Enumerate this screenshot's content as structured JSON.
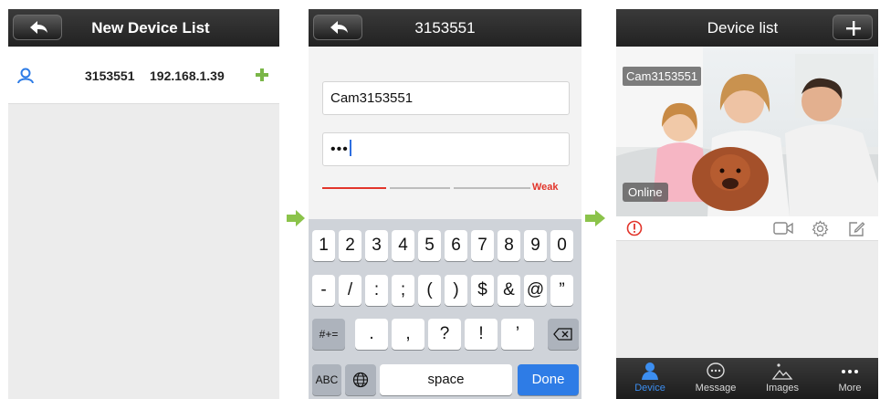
{
  "panel1": {
    "title": "New Device List",
    "row": {
      "device_id": "3153551",
      "ip": "192.168.1.39"
    }
  },
  "panel2": {
    "title": "3153551",
    "name_value": "Cam3153551",
    "password_mask": "•••",
    "strength_label": "Weak",
    "keyboard": {
      "row1": [
        "1",
        "2",
        "3",
        "4",
        "5",
        "6",
        "7",
        "8",
        "9",
        "0"
      ],
      "row2": [
        "-",
        "/",
        ":",
        ";",
        "(",
        ")",
        "$",
        "&",
        "@",
        "”"
      ],
      "row3": [
        ".",
        ",",
        "?",
        "!",
        "’"
      ],
      "symbols_key": "#+=",
      "abc_key": "ABC",
      "space_key": "space",
      "done_key": "Done"
    }
  },
  "panel3": {
    "title": "Device list",
    "camera_label": "Cam3153551",
    "status": "Online",
    "tabs": [
      "Device",
      "Message",
      "Images",
      "More"
    ]
  },
  "colors": {
    "accent_blue": "#2e7ce6",
    "weak_red": "#e2352b",
    "add_green": "#7ab648",
    "arrow_green": "#8bc34a"
  }
}
